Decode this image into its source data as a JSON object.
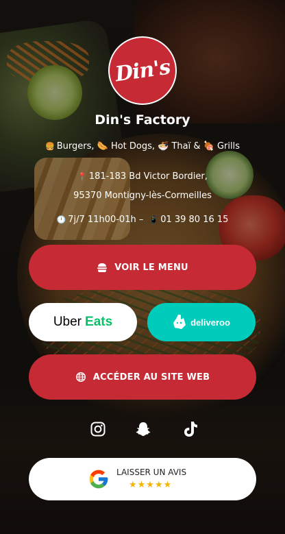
{
  "brand": {
    "logo_text": "Din's",
    "name": "Din's Factory"
  },
  "tagline": "Burgers, 🌭 Hot Dogs, 🍜 Thaï & 🍖 Grills",
  "tagline_prefix_icon": "burger-emoji",
  "address": {
    "line1": "181-183 Bd Victor Bordier,",
    "line2": "95370 Montigny-lès-Cormeilles"
  },
  "hours": {
    "open": "7j/7 11h00-01h –",
    "phone": "01 39 80 16 15"
  },
  "buttons": {
    "menu": "VOIR LE MENU",
    "uber_part1": "Uber",
    "uber_part2": "Eats",
    "deliveroo": "deliveroo",
    "website": "ACCÉDER AU SITE WEB",
    "review": "LAISSER UN AVIS",
    "stars": "★★★★★"
  },
  "socials": [
    "instagram-icon",
    "snapchat-icon",
    "tiktok-icon"
  ],
  "colors": {
    "brand_red": "#c52a35",
    "deliveroo": "#00ccbc",
    "uber_green": "#06c167",
    "star": "#f5b400"
  }
}
